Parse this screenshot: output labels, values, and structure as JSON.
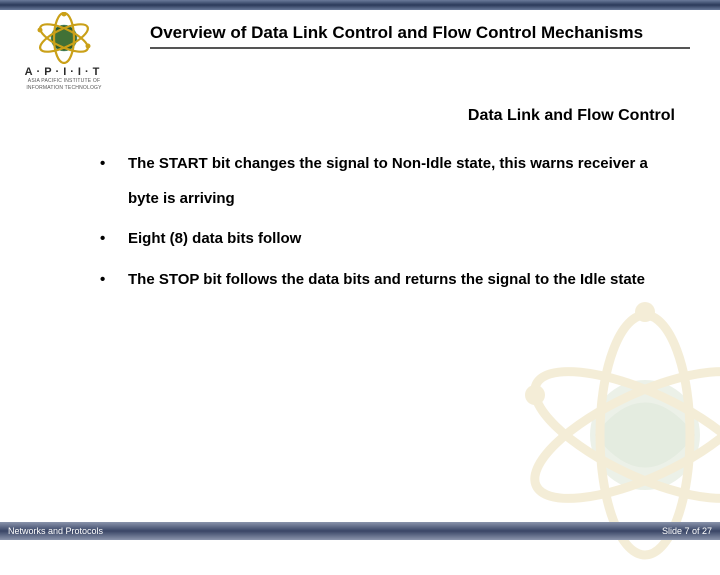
{
  "header": {
    "title": "Overview of Data Link Control and Flow Control Mechanisms",
    "logo_text": "A·P·I·I·T",
    "logo_sub1": "ASIA PACIFIC INSTITUTE OF",
    "logo_sub2": "INFORMATION TECHNOLOGY"
  },
  "subtitle": "Data Link and Flow Control",
  "bullets": [
    "The START bit changes the signal to Non-Idle state, this warns receiver a byte is arriving",
    "Eight (8) data bits follow",
    "The STOP bit follows the data bits and returns the signal to the Idle state"
  ],
  "footer": {
    "left": "Networks and Protocols",
    "right": "Slide 7 of 27"
  }
}
